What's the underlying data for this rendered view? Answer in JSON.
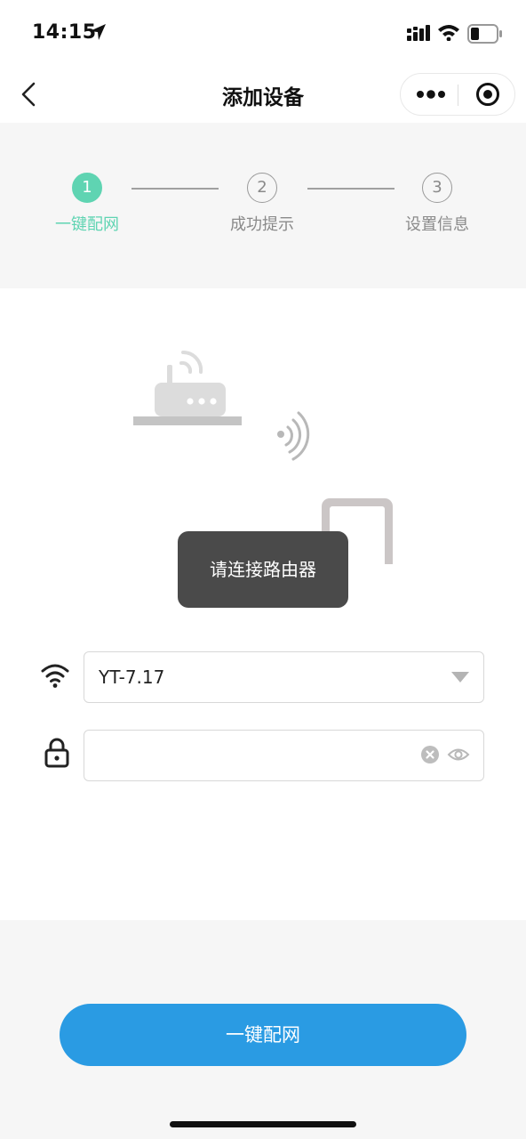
{
  "status_bar": {
    "time": "14:15",
    "icons": [
      "location-arrow-icon",
      "cellular-signal-icon",
      "wifi-icon",
      "battery-icon"
    ]
  },
  "nav": {
    "title": "添加设备",
    "icons": [
      "back-chevron-icon",
      "more-dots-icon",
      "target-circle-icon"
    ]
  },
  "steps": [
    {
      "number": "1",
      "label": "一键配网",
      "active": true
    },
    {
      "number": "2",
      "label": "成功提示",
      "active": false
    },
    {
      "number": "3",
      "label": "设置信息",
      "active": false
    }
  ],
  "toast": "请连接路由器",
  "form": {
    "ssid": {
      "value": "YT-7.17",
      "icon": "wifi-icon"
    },
    "password": {
      "value": "",
      "icon": "lock-icon"
    }
  },
  "primary_button_label": "一键配网",
  "colors": {
    "accent_green": "#5fd4b2",
    "primary_blue": "#2a9be3",
    "toast_bg": "#4a4a4a"
  }
}
